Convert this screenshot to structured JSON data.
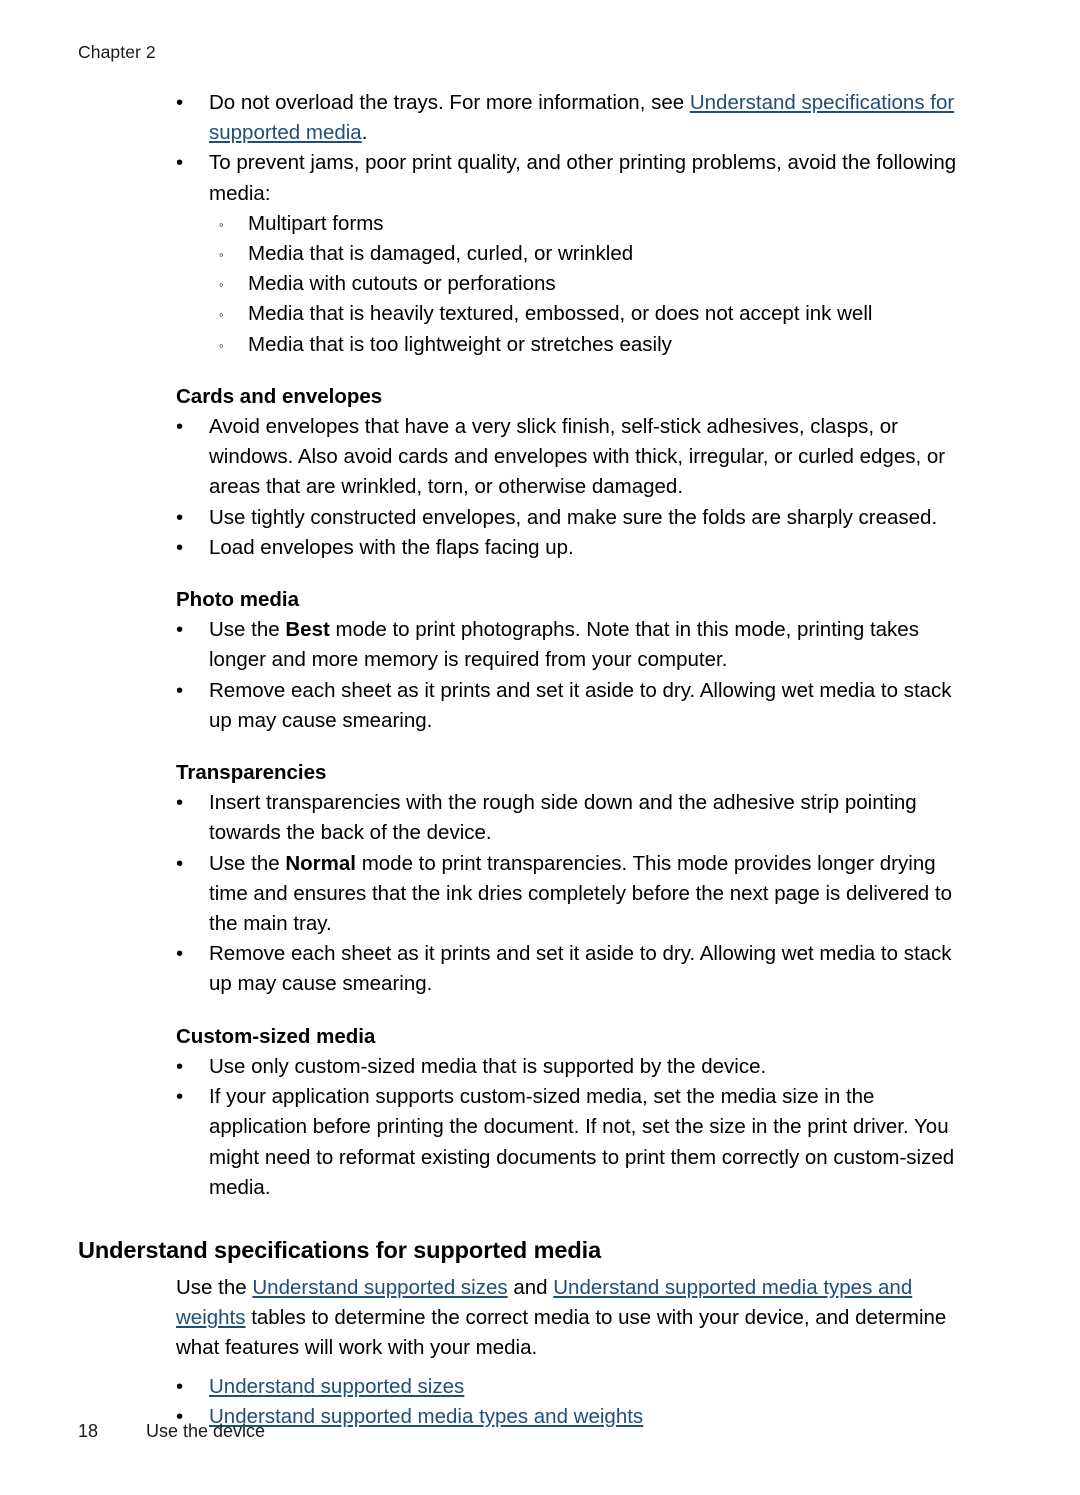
{
  "page": {
    "running_header": "Chapter 2",
    "footer": {
      "page_number": "18",
      "section_title": "Use the device"
    },
    "link_color": "#1F4E79",
    "text_color": "#000000",
    "background_color": "#FFFFFF",
    "bullet_glyph": "•",
    "sub_bullet_glyph": "◦"
  },
  "intro_list": [
    {
      "parts": [
        {
          "type": "text",
          "text": "Do not overload the trays. For more information, see "
        },
        {
          "type": "link",
          "text": "Understand specifications for supported media"
        },
        {
          "type": "text",
          "text": "."
        }
      ]
    },
    {
      "parts": [
        {
          "type": "text",
          "text": "To prevent jams, poor print quality, and other printing problems, avoid the following media:"
        }
      ],
      "sub_items": [
        "Multipart forms",
        "Media that is damaged, curled, or wrinkled",
        "Media with cutouts or perforations",
        "Media that is heavily textured, embossed, or does not accept ink well",
        "Media that is too lightweight or stretches easily"
      ]
    }
  ],
  "sections": [
    {
      "heading": "Cards and envelopes",
      "items": [
        {
          "parts": [
            {
              "type": "text",
              "text": "Avoid envelopes that have a very slick finish, self-stick adhesives, clasps, or windows. Also avoid cards and envelopes with thick, irregular, or curled edges, or areas that are wrinkled, torn, or otherwise damaged."
            }
          ]
        },
        {
          "parts": [
            {
              "type": "text",
              "text": "Use tightly constructed envelopes, and make sure the folds are sharply creased."
            }
          ]
        },
        {
          "parts": [
            {
              "type": "text",
              "text": "Load envelopes with the flaps facing up."
            }
          ]
        }
      ]
    },
    {
      "heading": "Photo media",
      "items": [
        {
          "parts": [
            {
              "type": "text",
              "text": "Use the "
            },
            {
              "type": "bold",
              "text": "Best"
            },
            {
              "type": "text",
              "text": " mode to print photographs. Note that in this mode, printing takes longer and more memory is required from your computer."
            }
          ]
        },
        {
          "parts": [
            {
              "type": "text",
              "text": "Remove each sheet as it prints and set it aside to dry. Allowing wet media to stack up may cause smearing."
            }
          ]
        }
      ]
    },
    {
      "heading": "Transparencies",
      "items": [
        {
          "parts": [
            {
              "type": "text",
              "text": "Insert transparencies with the rough side down and the adhesive strip pointing towards the back of the device."
            }
          ]
        },
        {
          "parts": [
            {
              "type": "text",
              "text": "Use the "
            },
            {
              "type": "bold",
              "text": "Normal"
            },
            {
              "type": "text",
              "text": " mode to print transparencies. This mode provides longer drying time and ensures that the ink dries completely before the next page is delivered to the main tray."
            }
          ]
        },
        {
          "parts": [
            {
              "type": "text",
              "text": "Remove each sheet as it prints and set it aside to dry. Allowing wet media to stack up may cause smearing."
            }
          ]
        }
      ]
    },
    {
      "heading": "Custom-sized media",
      "items": [
        {
          "parts": [
            {
              "type": "text",
              "text": "Use only custom-sized media that is supported by the device."
            }
          ]
        },
        {
          "parts": [
            {
              "type": "text",
              "text": "If your application supports custom-sized media, set the media size in the application before printing the document. If not, set the size in the print driver. You might need to reformat existing documents to print them correctly on custom-sized media."
            }
          ]
        }
      ]
    }
  ],
  "main_section": {
    "heading": "Understand specifications for supported media",
    "paragraph": [
      {
        "type": "text",
        "text": "Use the "
      },
      {
        "type": "link",
        "text": "Understand supported sizes"
      },
      {
        "type": "text",
        "text": " and "
      },
      {
        "type": "link",
        "text": "Understand supported media types and weights"
      },
      {
        "type": "text",
        "text": " tables to determine the correct media to use with your device, and determine what features will work with your media."
      }
    ],
    "links_list": [
      "Understand supported sizes",
      "Understand supported media types and weights"
    ]
  }
}
